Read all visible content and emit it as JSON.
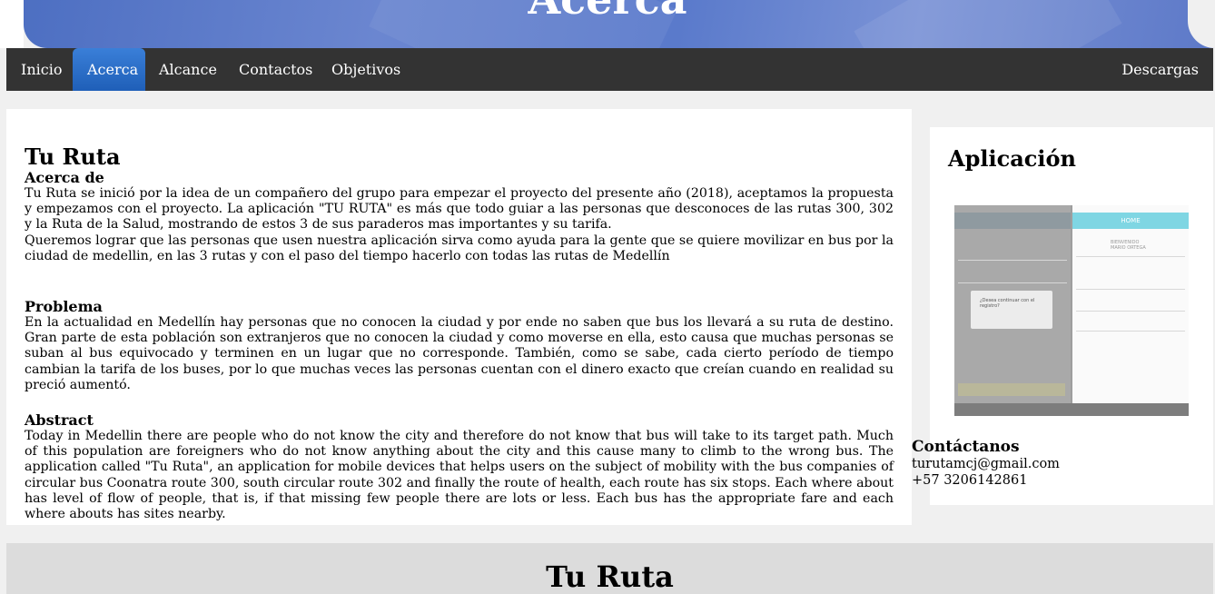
{
  "header": {
    "title": "Acerca"
  },
  "nav": {
    "items": [
      "Inicio",
      "Acerca",
      "Alcance",
      "Contactos",
      "Objetivos"
    ],
    "right": "Descargas"
  },
  "article": {
    "title": "Tu Ruta",
    "sections": [
      {
        "heading": "Acerca de",
        "paragraphs": [
          "Tu Ruta se inició por la idea de un compañero del grupo para empezar el proyecto del presente año (2018), aceptamos la propuesta y empezamos con el proyecto. La aplicación \"TU RUTA\" es más que todo guiar a las personas que desconoces de las rutas 300, 302 y la Ruta de la Salud, mostrando de estos 3 de sus paraderos mas importantes y su tarifa.",
          "Queremos lograr que las personas que usen nuestra aplicación sirva como ayuda para la gente que se quiere movilizar en bus por la ciudad de medellin, en las 3 rutas y con el paso del tiempo hacerlo con todas las rutas de Medellín"
        ]
      },
      {
        "heading": "Problema",
        "paragraphs": [
          "En la actualidad en Medellín hay personas que no conocen la ciudad y por ende no saben que bus los llevará a su ruta de destino. Gran parte de esta población son extranjeros que no conocen la ciudad y como moverse en ella, esto causa que muchas personas se suban al bus equivocado y terminen en un lugar que no corresponde. También, como se sabe, cada cierto período de tiempo cambian la tarifa de los buses, por lo que muchas veces las personas cuentan con el dinero exacto que creían cuando en realidad su preció aumentó."
        ]
      },
      {
        "heading": "Abstract",
        "paragraphs": [
          "Today in Medellin there are people who do not know the city and therefore do not know that bus will take to its target path. Much of this population are foreigners who do not know anything about the city and this cause many to climb to the wrong bus. The application called \"Tu Ruta\", an application for mobile devices that helps users on the subject of mobility with the bus companies of circular bus Coonatra route 300, south circular route 302 and finally the route of health, each route has six stops. Each where about has level of flow of people, that is, if that missing few people there are lots or less. Each bus has the appropriate fare and each where abouts has sites nearby."
        ]
      }
    ]
  },
  "aside": {
    "title": "Aplicación",
    "screenshot": {
      "home_label": "HOME",
      "welcome": "BIENVENIDO",
      "user": "MARIO ORTEGA",
      "dialog_text": "¿Desea continuar con el registro?"
    },
    "contact": {
      "title": "Contáctanos",
      "email": "turutamcj@gmail.com",
      "phone": "+57 3206142861"
    }
  },
  "footer": {
    "title": "Tu Ruta"
  }
}
